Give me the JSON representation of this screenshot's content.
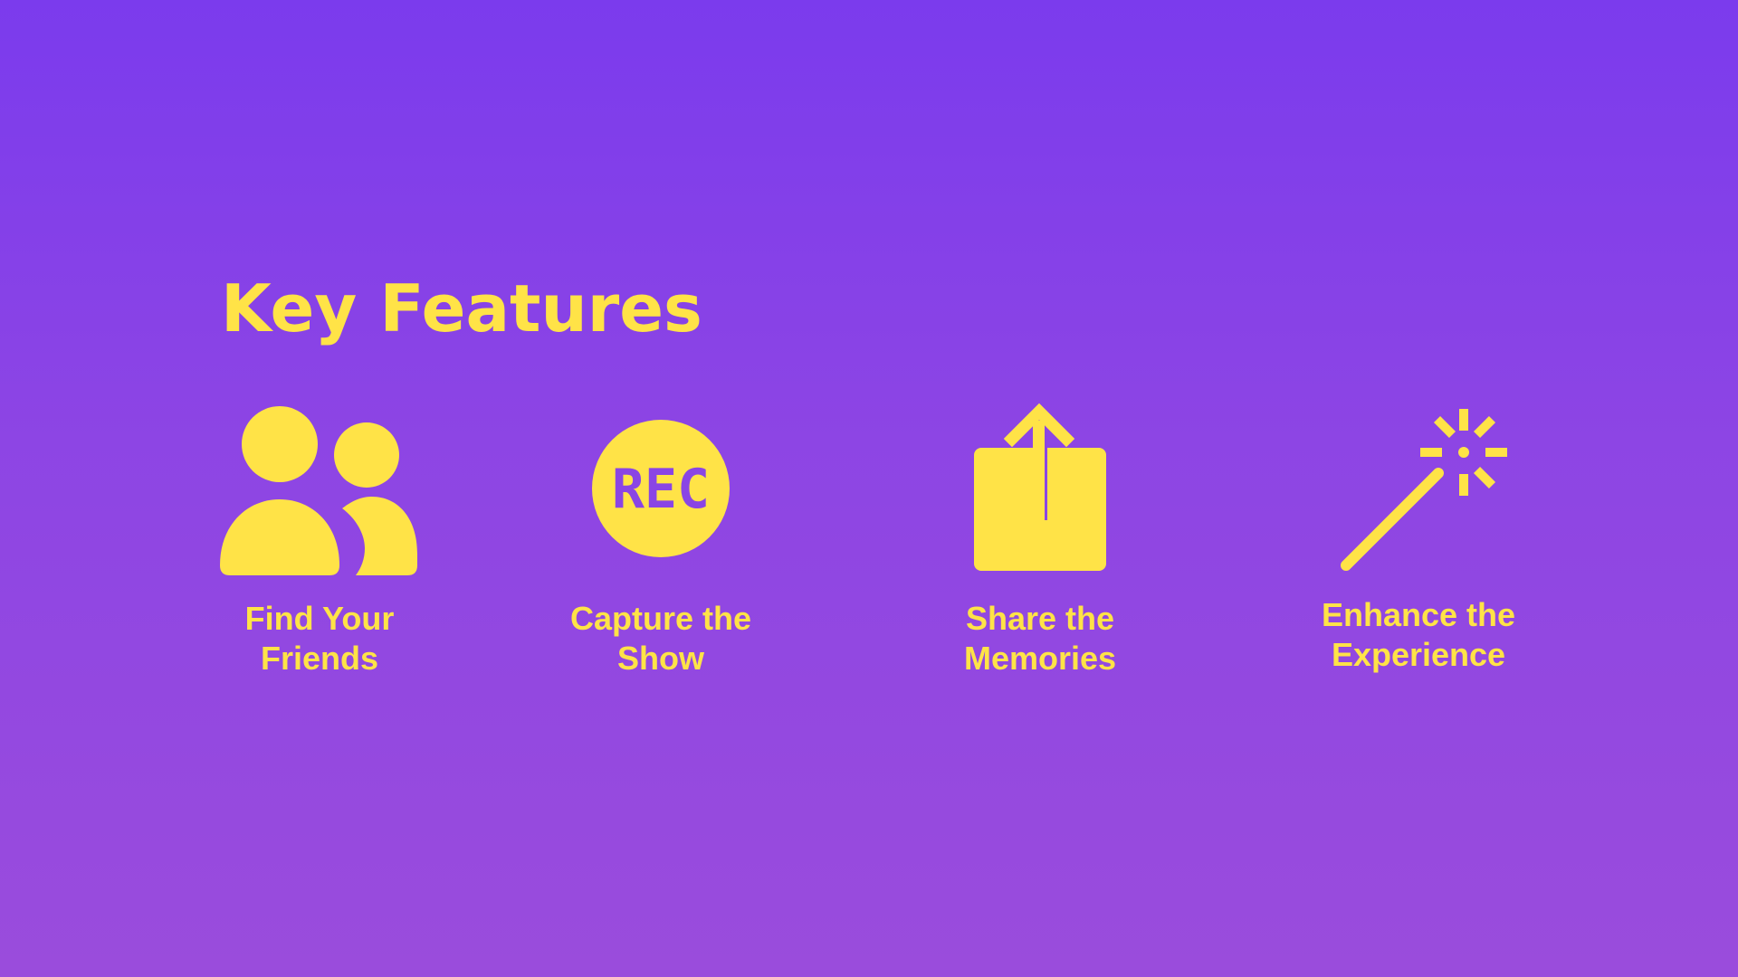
{
  "heading": "Key Features",
  "colors": {
    "accent": "#ffe347",
    "background_top": "#7b3bed",
    "background_bottom": "#9a4cdc"
  },
  "features": [
    {
      "icon": "users-icon",
      "line1": "Find Your",
      "line2": "Friends"
    },
    {
      "icon": "rec-icon",
      "icon_text": "REC",
      "line1": "Capture the",
      "line2": "Show"
    },
    {
      "icon": "share-icon",
      "line1": "Share the",
      "line2": "Memories"
    },
    {
      "icon": "magic-wand-icon",
      "line1": "Enhance the",
      "line2": "Experience"
    }
  ]
}
